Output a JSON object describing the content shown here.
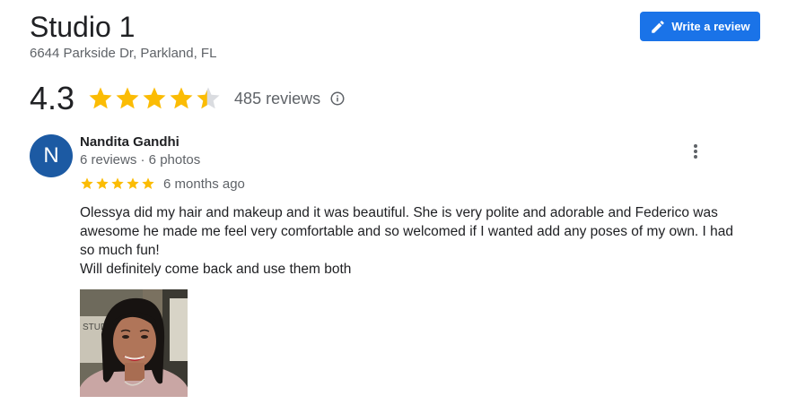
{
  "business": {
    "name": "Studio 1",
    "address": "6644 Parkside Dr, Parkland, FL",
    "rating": "4.3",
    "review_count": "485 reviews",
    "write_review_label": "Write a review"
  },
  "review": {
    "avatar_initial": "N",
    "reviewer_name": "Nandita Gandhi",
    "reviewer_meta": "6 reviews · 6 photos",
    "stars": 5,
    "time": "6 months ago",
    "text_line1": "Olessya did my hair and makeup and it was beautiful. She is very polite and adorable and Federico was awesome he made me feel very comfortable and so welcomed if I wanted add any poses of my own. I had so much fun!",
    "text_line2": "Will definitely come back and use them both",
    "photo_sign_text": "STUD"
  },
  "colors": {
    "star": "#fbbc04",
    "star_empty": "#dadce0",
    "button": "#1a73e8",
    "avatar": "#1c5aa3"
  },
  "icons": {
    "write_review": "pencil-icon",
    "info": "info-icon",
    "more": "more-vert-icon"
  }
}
